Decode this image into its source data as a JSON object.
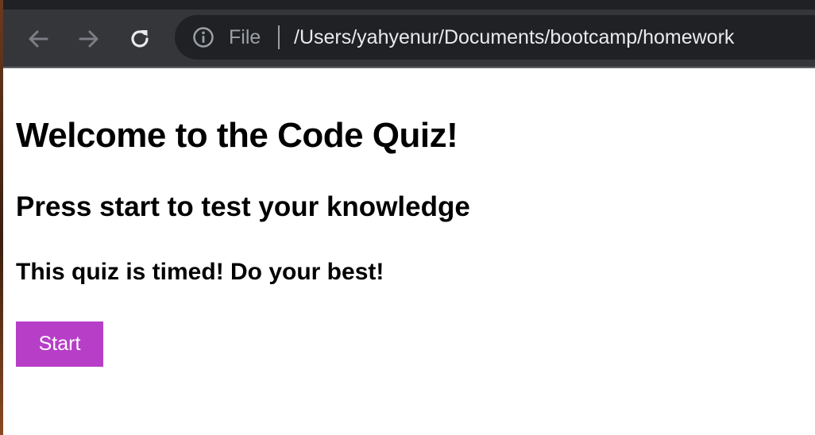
{
  "browser": {
    "back_icon": "arrow-left-icon",
    "forward_icon": "arrow-right-icon",
    "reload_icon": "reload-icon",
    "info_icon": "info-circle-icon",
    "scheme_label": "File",
    "url": "/Users/yahyenur/Documents/bootcamp/homework",
    "colors": {
      "tabstrip": "#202124",
      "toolbar": "#35363a",
      "omnibox": "#202124",
      "url_text": "#e8eaed",
      "muted_text": "#9aa0a6"
    }
  },
  "page": {
    "title": "Welcome to the Code Quiz!",
    "subtitle": "Press start to test your knowledge",
    "note": "This quiz is timed! Do your best!",
    "start_button_label": "Start",
    "colors": {
      "start_button": "#b73ec7",
      "start_button_text": "#ffffff",
      "heading_text": "#000000",
      "background": "#ffffff"
    }
  }
}
